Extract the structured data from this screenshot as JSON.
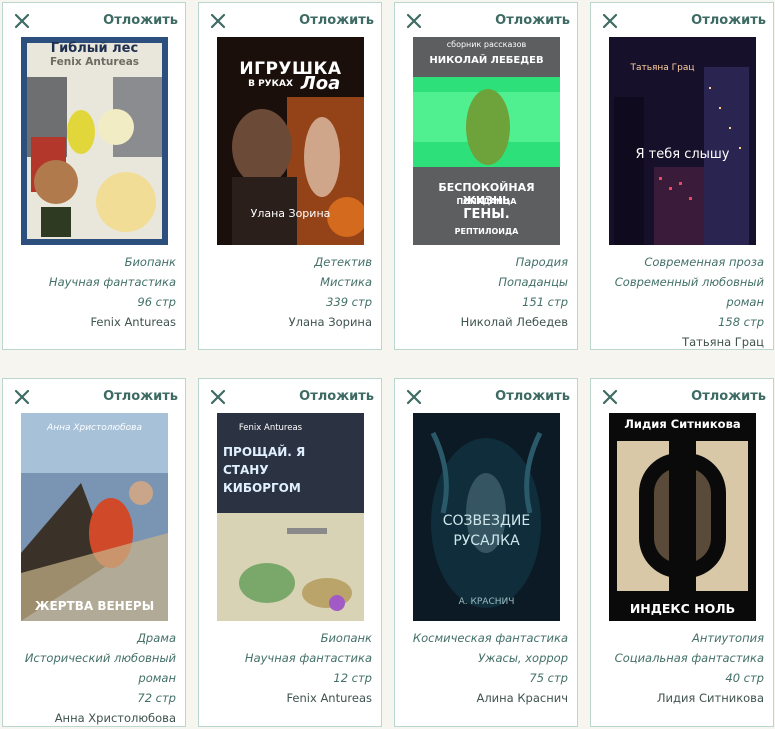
{
  "ui": {
    "postpone_label": "Отложить"
  },
  "books": [
    {
      "cover_top": "Гиблый лес",
      "cover_sub": "Fenix Antureas",
      "genres": [
        "Биопанк",
        "Научная фантастика"
      ],
      "pages": "96 стр",
      "author": "Fenix Antureas"
    },
    {
      "cover_top": "ИГРУШКА",
      "cover_sub": "В РУКАХ",
      "cover_extra": "Лоа",
      "cover_bottom": "Улана Зорина",
      "genres": [
        "Детектив",
        "Мистика"
      ],
      "pages": "339 стр",
      "author": "Улана Зорина"
    },
    {
      "cover_top": "сборник рассказов",
      "cover_sub": "НИКОЛАЙ ЛЕБЕДЕВ",
      "cover_bottom": "БЕСПОКОЙНАЯ ЖИЗНЬ",
      "cover_extra": "ПОПАДАНЦА",
      "cover_extra2": "ГЕНЫ.",
      "cover_extra3": "РЕПТИЛОИДА",
      "genres": [
        "Пародия",
        "Попаданцы"
      ],
      "pages": "151 стр",
      "author": "Николай Лебедев"
    },
    {
      "cover_top": "Татьяна Грац",
      "cover_sub": "Я тебя слышу",
      "genres": [
        "Современная проза",
        "Современный любовный роман"
      ],
      "pages": "158 стр",
      "author": "Татьяна Грац"
    },
    {
      "cover_top": "Анна Христолюбова",
      "cover_bottom": "ЖЕРТВА ВЕНЕРЫ",
      "genres": [
        "Драма",
        "Исторический любовный роман"
      ],
      "pages": "72 стр",
      "author": "Анна Христолюбова"
    },
    {
      "cover_top": "Fenix Antureas",
      "cover_sub": "ПРОЩАЙ. Я СТАНУ КИБОРГОМ",
      "genres": [
        "Биопанк",
        "Научная фантастика"
      ],
      "pages": "12 стр",
      "author": "Fenix Antureas"
    },
    {
      "cover_top": "СОЗВЕЗДИЕ",
      "cover_sub": "РУСАЛКА",
      "cover_bottom": "А. КРАСНИЧ",
      "genres": [
        "Космическая фантастика",
        "Ужасы, хоррор"
      ],
      "pages": "75 стр",
      "author": "Алина Краснич"
    },
    {
      "cover_top": "Лидия Ситникова",
      "cover_bottom": "ИНДЕКС НОЛЬ",
      "genres": [
        "Антиутопия",
        "Социальная фантастика"
      ],
      "pages": "40 стр",
      "author": "Лидия Ситникова"
    }
  ]
}
